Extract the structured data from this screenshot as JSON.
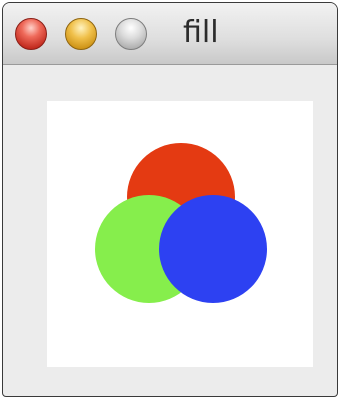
{
  "window": {
    "title": "fill"
  },
  "titlebar_buttons": [
    {
      "name": "close",
      "color": "#e2473a"
    },
    {
      "name": "minimize",
      "color": "#e8a92c"
    },
    {
      "name": "zoom",
      "color": "#c8c8c8"
    }
  ],
  "canvas": {
    "background": "#ffffff",
    "circles": [
      {
        "name": "red",
        "fill": "#e43a12"
      },
      {
        "name": "green",
        "fill": "#86ee4c"
      },
      {
        "name": "blue",
        "fill": "#2d41f2"
      }
    ]
  }
}
